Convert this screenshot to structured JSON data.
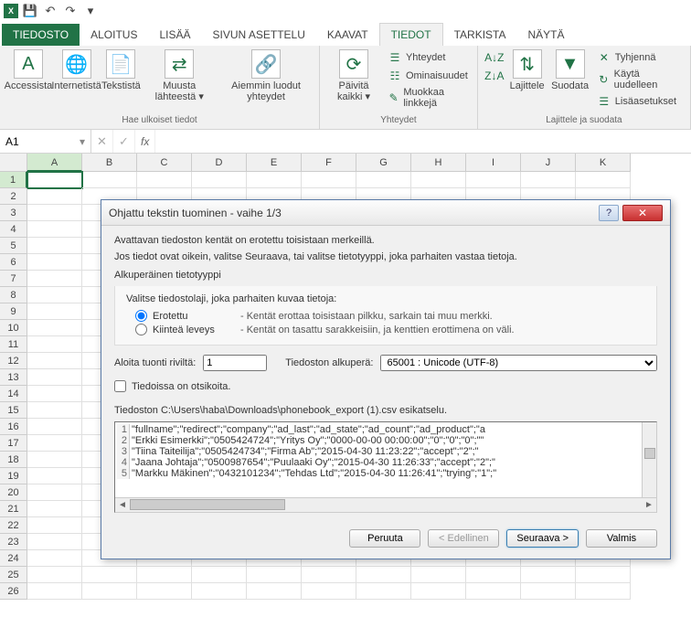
{
  "titlebar": {
    "save_tip": "Tallenna",
    "undo_tip": "Kumoa",
    "redo_tip": "Tee uudelleen"
  },
  "tabs": {
    "file": "TIEDOSTO",
    "home": "ALOITUS",
    "insert": "LISÄÄ",
    "layout": "SIVUN ASETTELU",
    "formulas": "KAAVAT",
    "data": "TIEDOT",
    "review": "TARKISTA",
    "view": "NÄYTÄ"
  },
  "ribbon": {
    "access": "Accessista",
    "web": "Internetistä",
    "text": "Tekstistä",
    "other": "Muusta lähteestä ▾",
    "existing": "Aiemmin luodut yhteydet",
    "group_get": "Hae ulkoiset tiedot",
    "refresh": "Päivitä kaikki ▾",
    "connections": "Yhteydet",
    "properties": "Ominaisuudet",
    "editlinks": "Muokkaa linkkejä",
    "group_conn": "Yhteydet",
    "sort_az": "A↓Z",
    "sort_za": "Z↓A",
    "sort": "Lajittele",
    "filter": "Suodata",
    "clear": "Tyhjennä",
    "reapply": "Käytä uudelleen",
    "advanced": "Lisäasetukset",
    "group_sort": "Lajittele ja suodata"
  },
  "formula": {
    "cell_ref": "A1",
    "fx": "fx"
  },
  "grid": {
    "cols": [
      "A",
      "B",
      "C",
      "D",
      "E",
      "F",
      "G",
      "H",
      "I",
      "J",
      "K"
    ],
    "rows": [
      "1",
      "2",
      "3",
      "4",
      "5",
      "6",
      "7",
      "8",
      "9",
      "10",
      "11",
      "12",
      "13",
      "14",
      "15",
      "16",
      "17",
      "18",
      "19",
      "20",
      "21",
      "22",
      "23",
      "24",
      "25",
      "26"
    ]
  },
  "dialog": {
    "title": "Ohjattu tekstin tuominen - vaihe 1/3",
    "intro1": "Avattavan tiedoston kentät on erotettu toisistaan merkeillä.",
    "intro2": "Jos tiedot ovat oikein, valitse Seuraava, tai valitse tietotyyppi, joka parhaiten vastaa tietoja.",
    "orig_type_label": "Alkuperäinen tietotyyppi",
    "choose_desc": "Valitse tiedostolaji, joka parhaiten kuvaa tietoja:",
    "radio_delim": "Erotettu",
    "radio_delim_desc": "- Kentät erottaa toisistaan pilkku, sarkain tai muu merkki.",
    "radio_fixed": "Kiinteä leveys",
    "radio_fixed_desc": "- Kentät on tasattu sarakkeisiin, ja kenttien erottimena on väli.",
    "start_row_label": "Aloita tuonti riviltä:",
    "start_row_value": "1",
    "origin_label": "Tiedoston alkuperä:",
    "origin_value": "65001 : Unicode (UTF-8)",
    "headers_chk": "Tiedoissa on otsikoita.",
    "preview_label": "Tiedoston C:\\Users\\haba\\Downloads\\phonebook_export (1).csv esikatselu.",
    "preview_lines": [
      {
        "n": "1",
        "t": "\"fullname\";\"redirect\";\"company\";\"ad_last\";\"ad_state\";\"ad_count\";\"ad_product\";\"a"
      },
      {
        "n": "2",
        "t": "\"Erkki Esimerkki\";\"0505424724\";\"Yritys Oy\";\"0000-00-00 00:00:00\";\"0\";\"0\";\"0\";\"\""
      },
      {
        "n": "3",
        "t": "\"Tiina Taiteilija\";\"0505424734\";\"Firma Ab\";\"2015-04-30 11:23:22\";\"accept\";\"2\";\""
      },
      {
        "n": "4",
        "t": "\"Jaana Johtaja\";\"0500987654\";\"Puulaaki Oy\";\"2015-04-30 11:26:33\";\"accept\";\"2\";\""
      },
      {
        "n": "5",
        "t": "\"Markku Mäkinen\";\"0432101234\";\"Tehdas Ltd\";\"2015-04-30 11:26:41\";\"trying\";\"1\";\""
      }
    ],
    "btn_cancel": "Peruuta",
    "btn_back": "< Edellinen",
    "btn_next": "Seuraava >",
    "btn_finish": "Valmis"
  }
}
